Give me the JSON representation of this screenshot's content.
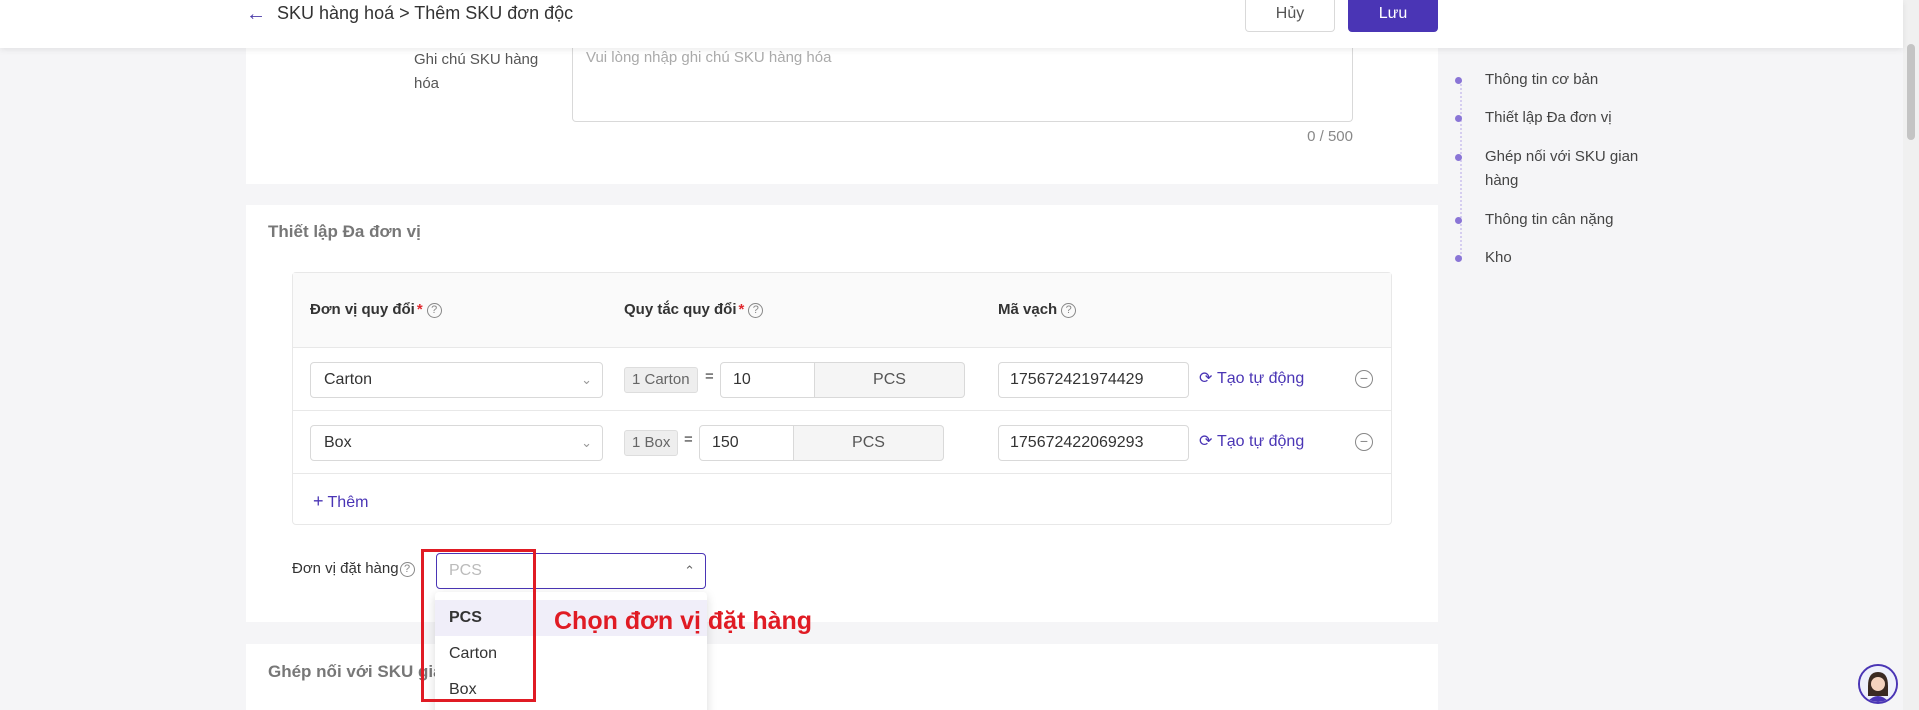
{
  "header": {
    "breadcrumb": "SKU hàng hoá > Thêm SKU đơn độc",
    "cancel_label": "Hủy",
    "save_label": "Lưu"
  },
  "note": {
    "label": "Ghi chú SKU hàng hóa",
    "placeholder": "Vui lòng nhập ghi chú SKU hàng hóa",
    "count": "0 / 500"
  },
  "multi_unit": {
    "title": "Thiết lập Đa đơn vị",
    "columns": {
      "unit": "Đơn vị quy đổi",
      "rule": "Quy tắc quy đổi",
      "barcode": "Mã vạch"
    },
    "rows": [
      {
        "unit": "Carton",
        "tag": "1 Carton",
        "eq": "=",
        "qty": "10",
        "base": "PCS",
        "barcode": "175672421974429",
        "auto": "Tạo tự động"
      },
      {
        "unit": "Box",
        "tag": "1 Box",
        "eq": "=",
        "qty": "150",
        "base": "PCS",
        "barcode": "175672422069293",
        "auto": "Tạo tự động"
      }
    ],
    "add_label": "Thêm",
    "order_unit_label": "Đơn vị đặt hàng",
    "order_unit_placeholder": "PCS",
    "options": [
      "PCS",
      "Carton",
      "Box"
    ]
  },
  "annotation": "Chọn đơn vị đặt hàng",
  "next_section_title": "Ghép nối với SKU gian",
  "anchors": [
    "Thông tin cơ bản",
    "Thiết lập Đa đơn vị",
    "Ghép nối với SKU gian hàng",
    "Thông tin cân nặng",
    "Kho"
  ],
  "icons": {
    "back": "arrow-left-icon",
    "help": "question-circle-icon",
    "chevron": "chevron-down-icon",
    "sync": "sync-icon",
    "remove": "minus-circle-icon",
    "plus": "plus-icon"
  },
  "colors": {
    "primary": "#4a35b5",
    "annotation": "#e01b24",
    "required": "#e0282e"
  }
}
